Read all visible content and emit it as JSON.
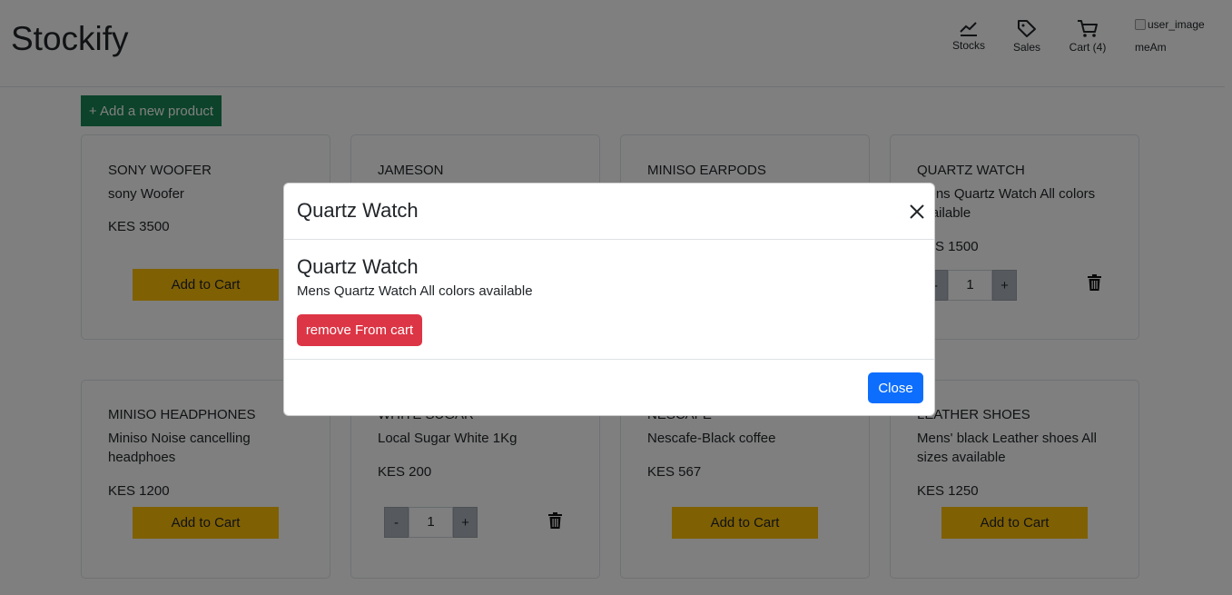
{
  "app": {
    "brand": "Stockify"
  },
  "nav": {
    "stocks": "Stocks",
    "sales": "Sales",
    "cart": "Cart (4)",
    "user_image_alt": "user_image",
    "username": "meAm"
  },
  "toolbar": {
    "add_product": "+ Add a new product"
  },
  "products": [
    {
      "name": "SONY WOOFER",
      "description": "sony Woofer",
      "price": "KES 3500",
      "action": "Add to Cart"
    },
    {
      "name": "JAMESON",
      "description": "",
      "price": "",
      "action": ""
    },
    {
      "name": "MINISO EARPODS",
      "description": "",
      "price": "",
      "action": ""
    },
    {
      "name": "QUARTZ WATCH",
      "description": "Mens Quartz Watch All colors available",
      "price": "KES 1500",
      "qty_minus": "-",
      "qty": "1",
      "qty_plus": "+"
    },
    {
      "name": "MINISO HEADPHONES",
      "description": "Miniso Noise cancelling headphoes",
      "price": "KES 1200",
      "action": "Add to Cart"
    },
    {
      "name": "WHITE SUGAR",
      "description": "Local Sugar White 1Kg",
      "price": "KES 200",
      "qty_minus": "-",
      "qty": "1",
      "qty_plus": "+"
    },
    {
      "name": "NESCAFE",
      "description": "Nescafe-Black coffee",
      "price": "KES 567",
      "action": "Add to Cart"
    },
    {
      "name": "LEATHER SHOES",
      "description": "Mens' black Leather shoes All sizes available",
      "price": "KES 1250",
      "action": "Add to Cart"
    }
  ],
  "modal": {
    "title": "Quartz Watch",
    "body_title": "Quartz Watch",
    "body_description": "Mens Quartz Watch All colors available",
    "remove_button": "remove From cart",
    "close_button": "Close"
  },
  "colors": {
    "add_product": "#198754",
    "add_to_cart": "#ffc107",
    "remove": "#dc3545",
    "close": "#0d6efd",
    "backdrop": "rgba(0,0,0,0.5)"
  },
  "icons": {
    "stocks": "chart-line-icon",
    "sales": "tag-icon",
    "cart": "cart-icon",
    "delete": "trash-icon",
    "close": "close-icon"
  }
}
